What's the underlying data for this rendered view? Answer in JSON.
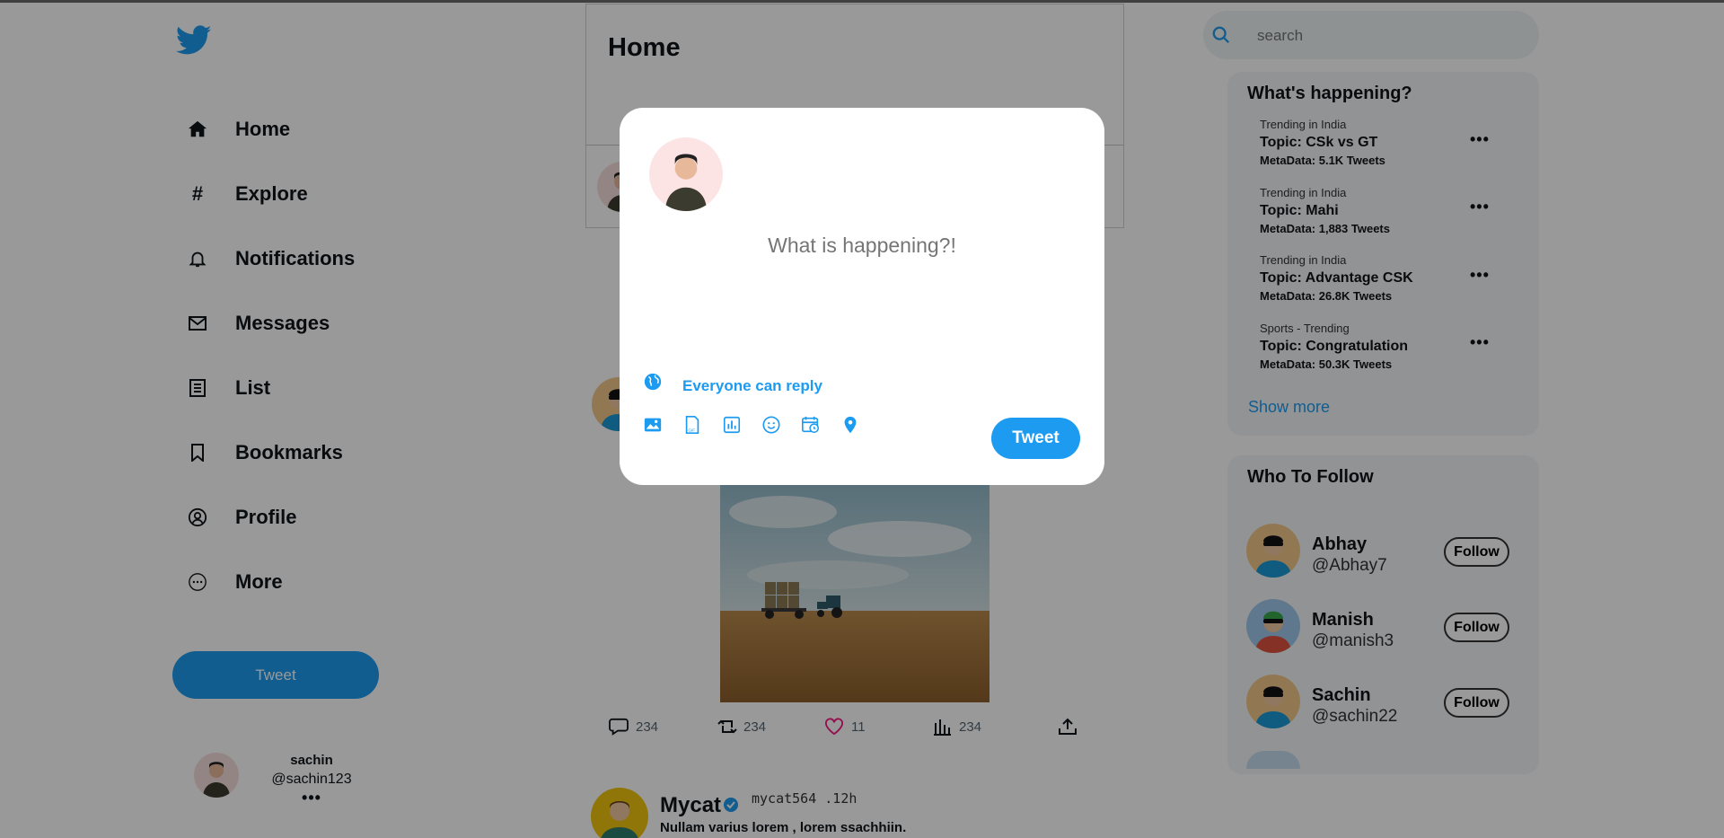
{
  "nav": {
    "items": [
      {
        "label": "Home",
        "icon": "home-icon"
      },
      {
        "label": "Explore",
        "icon": "hash-icon"
      },
      {
        "label": "Notifications",
        "icon": "bell-icon"
      },
      {
        "label": "Messages",
        "icon": "mail-icon"
      },
      {
        "label": "List",
        "icon": "list-icon"
      },
      {
        "label": "Bookmarks",
        "icon": "bookmark-icon"
      },
      {
        "label": "Profile",
        "icon": "user-circle-icon"
      },
      {
        "label": "More",
        "icon": "more-circle-icon"
      }
    ],
    "tweet_label": "Tweet"
  },
  "account": {
    "name": "sachin",
    "handle": "@sachin123",
    "more": "•••"
  },
  "main": {
    "title": "Home"
  },
  "post": {
    "actions": {
      "comments": "234",
      "retweets": "234",
      "likes": "11",
      "views": "234"
    }
  },
  "post2": {
    "name": "Mycat",
    "handle": "mycat564 .12h",
    "text": "Nullam varius lorem , lorem ssachhiin."
  },
  "search": {
    "placeholder": "search"
  },
  "trends": {
    "title": "What's happening?",
    "items": [
      {
        "context": "Trending in India",
        "topic": "Topic: CSk vs GT",
        "meta": "MetaData: 5.1K Tweets"
      },
      {
        "context": "Trending in India",
        "topic": "Topic: Mahi",
        "meta": "MetaData: 1,883 Tweets"
      },
      {
        "context": "Trending in India",
        "topic": "Topic: Advantage CSK",
        "meta": "MetaData: 26.8K Tweets"
      },
      {
        "context": "Sports - Trending",
        "topic": "Topic: Congratulation",
        "meta": "MetaData: 50.3K Tweets"
      }
    ],
    "more_glyph": "•••",
    "show_more": "Show more"
  },
  "follow": {
    "title": "Who To Follow",
    "users": [
      {
        "name": "Abhay",
        "handle": "@Abhay7",
        "button": "Follow"
      },
      {
        "name": "Manish",
        "handle": "@manish3",
        "button": "Follow"
      },
      {
        "name": "Sachin",
        "handle": "@sachin22",
        "button": "Follow"
      }
    ]
  },
  "modal": {
    "placeholder": "What is happening?!",
    "reply_setting": "Everyone can reply",
    "tools": [
      "image-icon",
      "gif-icon",
      "poll-icon",
      "emoji-icon",
      "schedule-icon",
      "location-icon"
    ],
    "tweet_label": "Tweet"
  },
  "colors": {
    "accent": "#1d9bf0",
    "overlay": "rgba(0,0,0,0.4)",
    "like": "#f91880"
  }
}
